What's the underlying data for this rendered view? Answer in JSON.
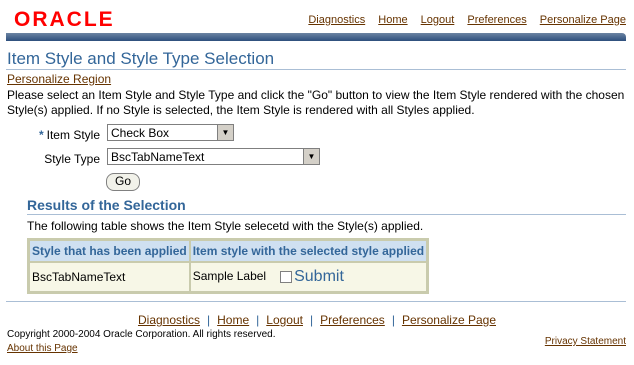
{
  "brand": {
    "logo_text": "ORACLE",
    "accent": "#336699",
    "link_color": "#663300",
    "logo_color": "#ff0000"
  },
  "global_links": [
    "Diagnostics",
    "Home",
    "Logout",
    "Preferences",
    "Personalize Page"
  ],
  "page": {
    "title": "Item Style and Style Type Selection",
    "personalize_region": "Personalize Region",
    "instructions": "Please select an Item Style and Style Type and click the \"Go\" button to view the Item Style rendered with the chosen Style(s) applied. If no Style is selected, the Item Style is rendered with all Styles applied."
  },
  "form": {
    "required_marker": "*",
    "item_style_label": "Item Style",
    "item_style_value": "Check Box",
    "style_type_label": "Style Type",
    "style_type_value": "BscTabNameText",
    "go_label": "Go"
  },
  "results": {
    "heading": "Results of the Selection",
    "description": "The following table shows the Item Style selecetd with the Style(s) applied.",
    "columns": [
      "Style that has been applied",
      "Item style with the selected style applied"
    ],
    "row": {
      "style": "BscTabNameText",
      "sample_label": "Sample Label",
      "submit_label": "Submit"
    }
  },
  "footer": {
    "links": [
      "Diagnostics",
      "Home",
      "Logout",
      "Preferences",
      "Personalize Page"
    ],
    "separator": "|",
    "copyright": "Copyright 2000-2004 Oracle Corporation. All rights reserved.",
    "about": "About this Page",
    "privacy": "Privacy Statement"
  }
}
